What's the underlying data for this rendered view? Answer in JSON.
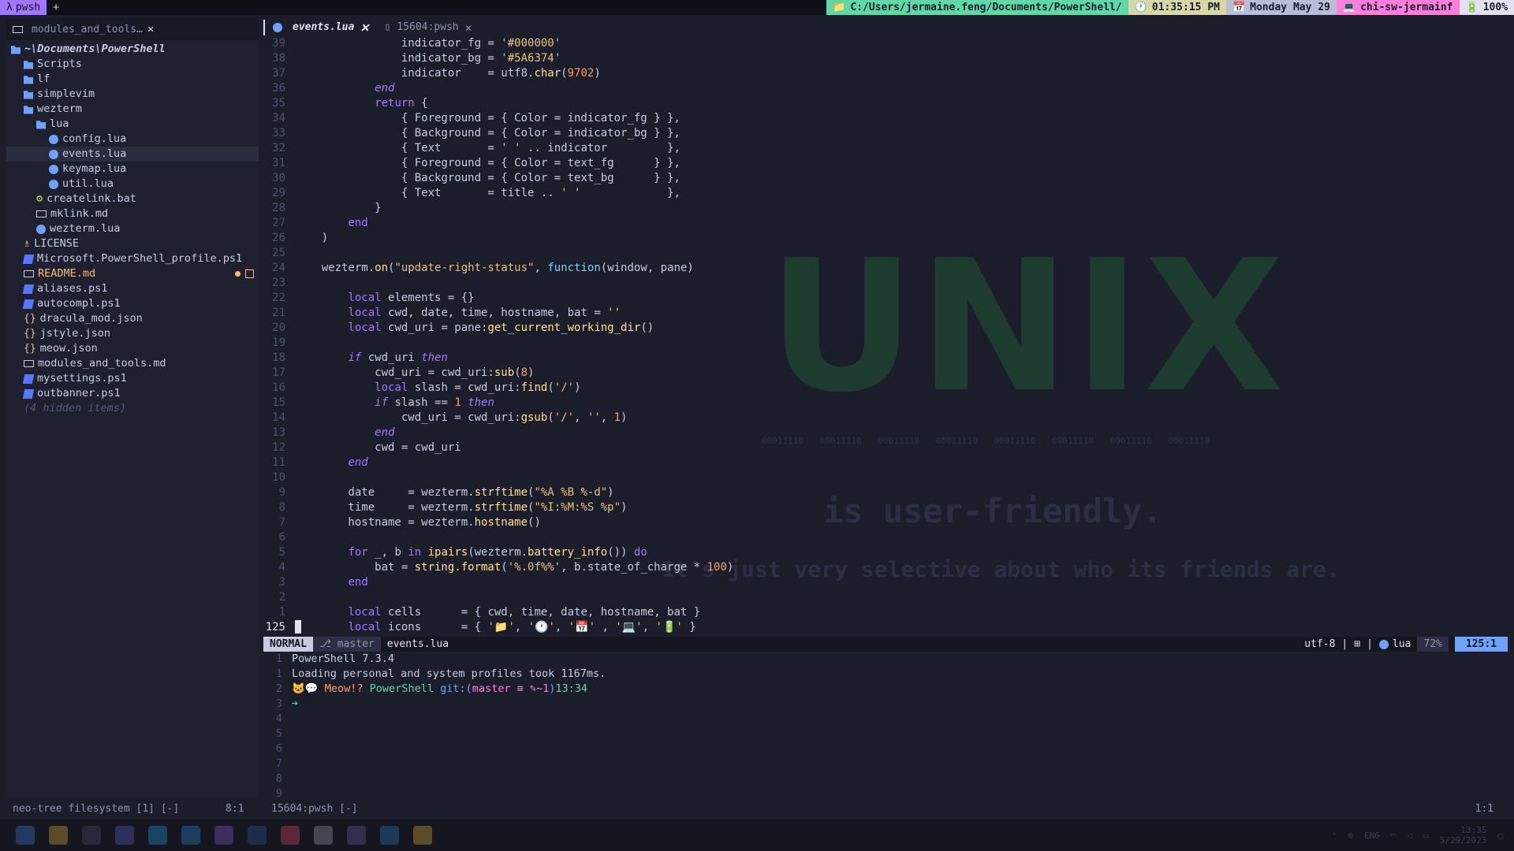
{
  "topbar": {
    "tab_label": "pwsh",
    "new_tab": "+",
    "cwd": "C:/Users/jermaine.feng/Documents/PowerShell/",
    "time": "01:35:15 PM",
    "date": "Monday May 29",
    "host": "chi-sw-jermainf",
    "battery": "100%"
  },
  "sidebar": {
    "tab1": "modules_and_tools…",
    "tab2": "events.lua",
    "tab3": "15604:pwsh",
    "root": "~\\Documents\\PowerShell",
    "items": [
      {
        "label": "Scripts",
        "type": "folder",
        "indent": 1
      },
      {
        "label": "lf",
        "type": "folder",
        "indent": 1
      },
      {
        "label": "simplevim",
        "type": "folder",
        "indent": 1
      },
      {
        "label": "wezterm",
        "type": "folder-open",
        "indent": 1
      },
      {
        "label": "lua",
        "type": "folder-open",
        "indent": 2
      },
      {
        "label": "config.lua",
        "type": "lua",
        "indent": 3
      },
      {
        "label": "events.lua",
        "type": "lua",
        "indent": 3,
        "selected": true
      },
      {
        "label": "keymap.lua",
        "type": "lua",
        "indent": 3
      },
      {
        "label": "util.lua",
        "type": "lua",
        "indent": 3
      },
      {
        "label": "createlink.bat",
        "type": "gear",
        "indent": 2
      },
      {
        "label": "mklink.md",
        "type": "md",
        "indent": 2
      },
      {
        "label": "wezterm.lua",
        "type": "lua",
        "indent": 2
      },
      {
        "label": "LICENSE",
        "type": "license",
        "indent": 1
      },
      {
        "label": "Microsoft.PowerShell_profile.ps1",
        "type": "ps1",
        "indent": 1
      },
      {
        "label": "README.md",
        "type": "md",
        "indent": 1,
        "modified": true
      },
      {
        "label": "aliases.ps1",
        "type": "ps1",
        "indent": 1
      },
      {
        "label": "autocompl.ps1",
        "type": "ps1",
        "indent": 1
      },
      {
        "label": "dracula_mod.json",
        "type": "json",
        "indent": 1
      },
      {
        "label": "jstyle.json",
        "type": "json",
        "indent": 1
      },
      {
        "label": "meow.json",
        "type": "json",
        "indent": 1
      },
      {
        "label": "modules_and_tools.md",
        "type": "md",
        "indent": 1
      },
      {
        "label": "mysettings.ps1",
        "type": "ps1",
        "indent": 1
      },
      {
        "label": "outbanner.ps1",
        "type": "ps1",
        "indent": 1
      }
    ],
    "hidden": "(4 hidden items)"
  },
  "editor": {
    "watermark": "UNIX",
    "watermark_bits": "00011110 00011110 00011110 00011110 00011110 00011110 00011110 00011110",
    "watermark_line1": "is user-friendly.",
    "watermark_line2": "It's just very selective about who its friends are.",
    "lines": [
      {
        "n": "39",
        "html": "                indicator_fg = <span class='str'>'#000000'</span>"
      },
      {
        "n": "38",
        "html": "                indicator_bg = <span class='str'>'#5A6374'</span>"
      },
      {
        "n": "37",
        "html": "                indicator    = utf8.<span class='fn'>char</span>(<span class='num'>9702</span>)"
      },
      {
        "n": "36",
        "html": "            <span class='kw'>end</span>"
      },
      {
        "n": "35",
        "html": "            <span class='kwn'>return</span> {"
      },
      {
        "n": "34",
        "html": "                { Foreground = { Color = indicator_fg } },"
      },
      {
        "n": "33",
        "html": "                { Background = { Color = indicator_bg } },"
      },
      {
        "n": "32",
        "html": "                { Text       = <span class='str'>' '</span> .. indicator         },"
      },
      {
        "n": "31",
        "html": "                { Foreground = { Color = text_fg      } },"
      },
      {
        "n": "30",
        "html": "                { Background = { Color = text_bg      } },"
      },
      {
        "n": "29",
        "html": "                { Text       = title .. <span class='str'>' '</span>             },"
      },
      {
        "n": "28",
        "html": "            }"
      },
      {
        "n": "27",
        "html": "        <span class='kwn'>end</span>"
      },
      {
        "n": "26",
        "html": "    )"
      },
      {
        "n": "25",
        "html": ""
      },
      {
        "n": "24",
        "html": "    wezterm.<span class='fn'>on</span>(<span class='str'>\"update-right-status\"</span>, <span class='method'>function</span>(window, pane)"
      },
      {
        "n": "23",
        "html": ""
      },
      {
        "n": "22",
        "html": "        <span class='kwn'>local</span> elements = {}"
      },
      {
        "n": "21",
        "html": "        <span class='kwn'>local</span> cwd, date, time, hostname, bat = <span class='str'>''</span>"
      },
      {
        "n": "20",
        "html": "        <span class='kwn'>local</span> cwd_uri = pane:<span class='fn'>get_current_working_dir</span>()"
      },
      {
        "n": "19",
        "html": ""
      },
      {
        "n": "18",
        "html": "        <span class='kw'>if</span> cwd_uri <span class='kw'>then</span>"
      },
      {
        "n": "17",
        "html": "            cwd_uri = cwd_uri:<span class='fn'>sub</span>(<span class='num'>8</span>)"
      },
      {
        "n": "16",
        "html": "            <span class='kwn'>local</span> slash = cwd_uri:<span class='fn'>find</span>(<span class='str'>'/'</span>)"
      },
      {
        "n": "15",
        "html": "            <span class='kw'>if</span> slash == <span class='num'>1</span> <span class='kw'>then</span>"
      },
      {
        "n": "14",
        "html": "                cwd_uri = cwd_uri:<span class='fn'>gsub</span>(<span class='str'>'/'</span>, <span class='str'>''</span>, <span class='num'>1</span>)"
      },
      {
        "n": "13",
        "html": "            <span class='kw'>end</span>"
      },
      {
        "n": "12",
        "html": "            cwd = cwd_uri"
      },
      {
        "n": "11",
        "html": "        <span class='kw'>end</span>"
      },
      {
        "n": "10",
        "html": ""
      },
      {
        "n": "9",
        "html": "        date     = wezterm.<span class='fn'>strftime</span>(<span class='str'>\"%A %B %-d\"</span>)"
      },
      {
        "n": "8",
        "html": "        time     = wezterm.<span class='fn'>strftime</span>(<span class='str'>\"%I:%M:%S %p\"</span>)"
      },
      {
        "n": "7",
        "html": "        hostname = wezterm.<span class='fn'>hostname</span>()"
      },
      {
        "n": "6",
        "html": ""
      },
      {
        "n": "5",
        "html": "        <span class='kwn'>for</span> _, b <span class='kwn'>in</span> <span class='fn'>ipairs</span>(wezterm.<span class='fn'>battery_info</span>()) <span class='kwn'>do</span>"
      },
      {
        "n": "4",
        "html": "            bat = <span class='fn'>string.format</span>(<span class='str'>'%.0f%%'</span>, b.state_of_charge * <span class='num'>100</span>)"
      },
      {
        "n": "3",
        "html": "        <span class='kwn'>end</span>"
      },
      {
        "n": "2",
        "html": ""
      },
      {
        "n": "1",
        "html": "        <span class='kwn'>local</span> cells      = { cwd, time, date, hostname, bat }"
      },
      {
        "n": "125",
        "html": "        <span class='kwn'>local</span> icons      = { <span class='str'>'📁'</span>, <span class='str'>'🕐'</span>, <span class='str'>'📅'</span> , <span class='str'>'💻'</span>, <span class='str'>'🔋'</span> }",
        "current": true
      }
    ]
  },
  "statusline": {
    "mode": "NORMAL",
    "branch": "master",
    "file": "events.lua",
    "encoding": "utf-8",
    "filetype": "lua",
    "percent": "72%",
    "position": "125:1"
  },
  "terminal": {
    "lines": [
      {
        "n": "1",
        "text": "PowerShell 7.3.4"
      },
      {
        "n": "1",
        "text": "Loading personal and system profiles took 1167ms."
      },
      {
        "n": "2",
        "prompt": true,
        "meow": "Meow!?",
        "ps": "PowerShell",
        "git": "git:(",
        "branch": "master ≡ ✎~1",
        "close": ")",
        "time": "13:34"
      },
      {
        "n": "3",
        "text": "➔"
      },
      {
        "n": "4",
        "text": ""
      },
      {
        "n": "5",
        "text": ""
      },
      {
        "n": "6",
        "text": ""
      },
      {
        "n": "7",
        "text": ""
      },
      {
        "n": "8",
        "text": ""
      },
      {
        "n": "9",
        "text": ""
      }
    ]
  },
  "bottom": {
    "left": "neo-tree filesystem [1] [-]",
    "left_pos": "8:1",
    "mid": "15604:pwsh [-]",
    "right_pos": "1:1"
  },
  "taskbar": {
    "lang": "ENG",
    "clock": "13:35",
    "date": "5/29/2023"
  }
}
